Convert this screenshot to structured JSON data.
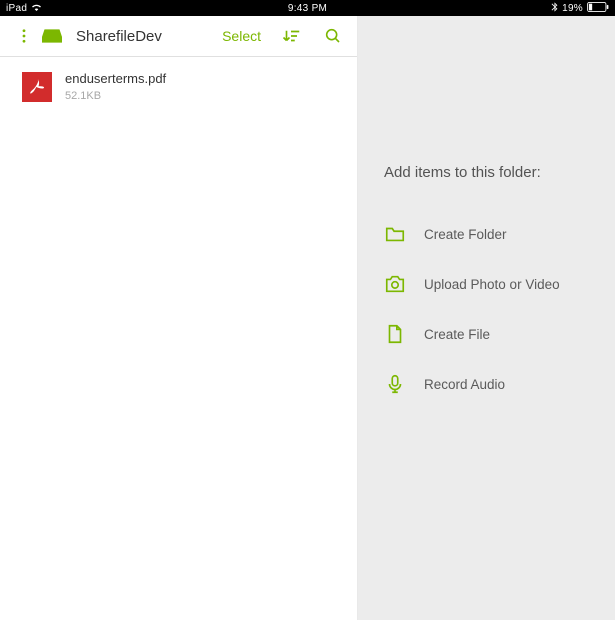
{
  "status": {
    "device": "iPad",
    "time": "9:43 PM",
    "battery_pct": "19%"
  },
  "toolbar": {
    "title": "SharefileDev",
    "select_label": "Select"
  },
  "files": [
    {
      "name": "enduserterms.pdf",
      "size": "52.1KB"
    }
  ],
  "panel": {
    "heading": "Add items to this folder:",
    "actions": [
      {
        "label": "Create Folder"
      },
      {
        "label": "Upload Photo or Video"
      },
      {
        "label": "Create File"
      },
      {
        "label": "Record Audio"
      }
    ]
  }
}
